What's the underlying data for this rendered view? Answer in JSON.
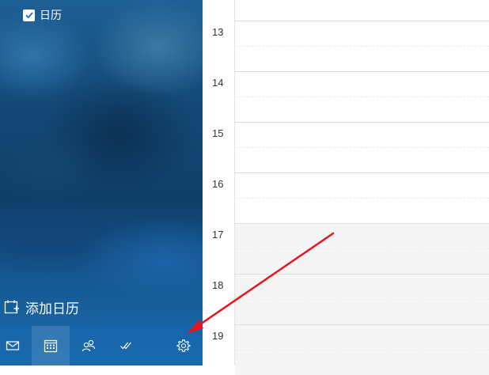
{
  "sidebar": {
    "calendar_checkbox_label": "日历",
    "add_calendar_label": "添加日历"
  },
  "bottom_bar": {
    "items": [
      {
        "name": "mail",
        "icon": "mail-icon"
      },
      {
        "name": "calendar",
        "icon": "calendar-icon",
        "active": true
      },
      {
        "name": "people",
        "icon": "people-icon"
      },
      {
        "name": "tasks",
        "icon": "double-check-icon"
      },
      {
        "name": "settings",
        "icon": "gear-icon"
      }
    ]
  },
  "day_view": {
    "hours": [
      "13",
      "14",
      "15",
      "16",
      "17",
      "18",
      "19"
    ]
  },
  "colors": {
    "annotation_arrow": "#e8141b",
    "nav_accent": "#1868af"
  }
}
